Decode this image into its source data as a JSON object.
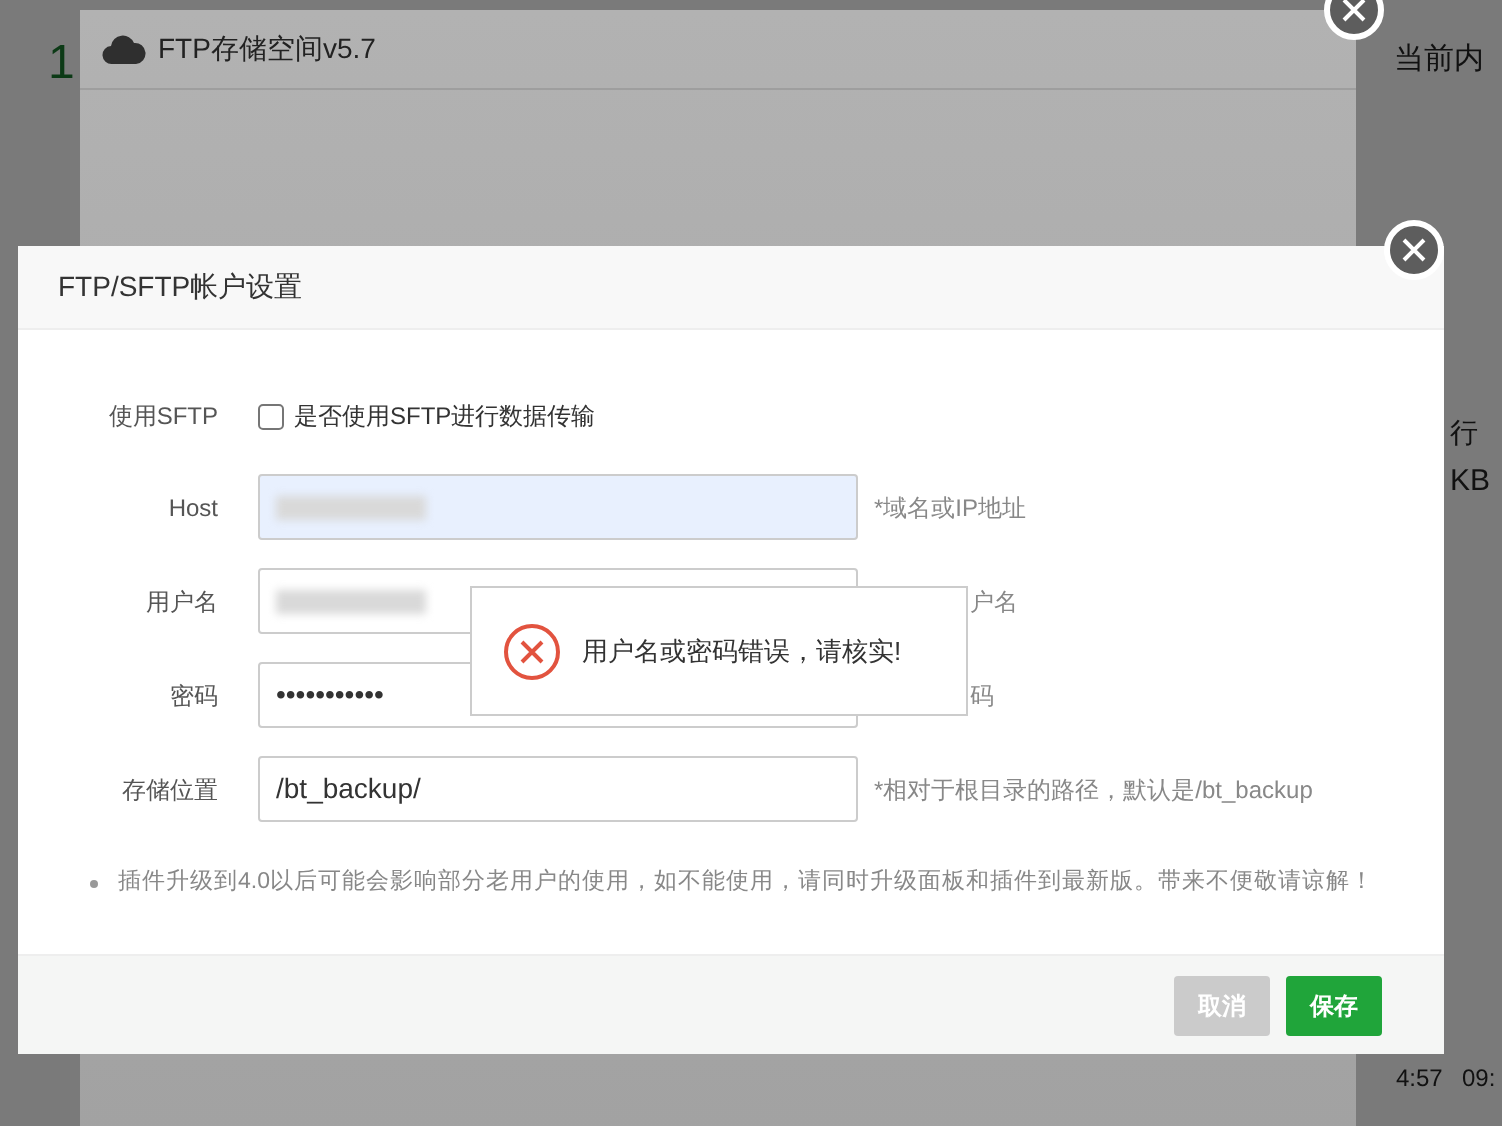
{
  "background": {
    "texts": [
      {
        "text": "1",
        "kind": "stat"
      },
      {
        "text": "当前内",
        "kind": "head"
      },
      {
        "text": "行",
        "kind": "side"
      },
      {
        "text": "KB",
        "kind": "side2"
      },
      {
        "text": "4:57",
        "kind": "time"
      },
      {
        "text": "09:",
        "kind": "time2"
      }
    ]
  },
  "plugin_window": {
    "title": "FTP存储空间v5.7"
  },
  "dialog": {
    "title": "FTP/SFTP帐户设置",
    "sftp": {
      "label": "使用SFTP",
      "option": "是否使用SFTP进行数据传输",
      "checked": false
    },
    "fields": [
      {
        "label": "Host",
        "kind": "blurred",
        "autofilled": true,
        "hint": "*域名或IP地址"
      },
      {
        "label": "用户名",
        "kind": "blurred",
        "autofilled": false,
        "hint": "户名"
      },
      {
        "label": "密码",
        "kind": "text",
        "value": "•••••••••••",
        "autofilled": false,
        "hint": "码"
      },
      {
        "label": "存储位置",
        "kind": "text",
        "value": "/bt_backup/",
        "autofilled": false,
        "hint": "*相对于根目录的路径，默认是/bt_backup"
      }
    ],
    "notes": [
      "插件升级到4.0以后可能会影响部分老用户的使用，如不能使用，请同时升级面板和插件到最新版。带来不便敬请谅解！"
    ],
    "buttons": [
      {
        "label": "取消",
        "kind": "cancel"
      },
      {
        "label": "保存",
        "kind": "primary"
      }
    ]
  },
  "toast": {
    "message": "用户名或密码错误，请核实!"
  }
}
